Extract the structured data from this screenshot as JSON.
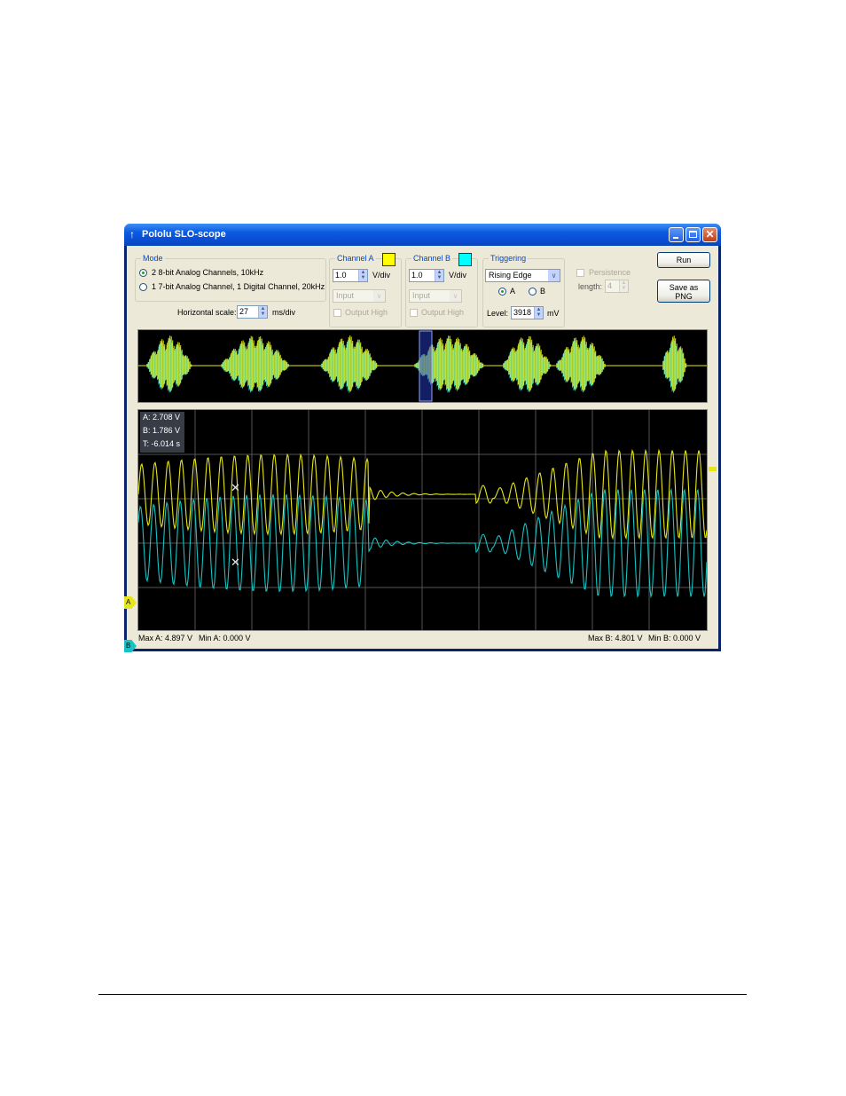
{
  "window": {
    "title": "Pololu SLO-scope"
  },
  "mode": {
    "legend": "Mode",
    "options": [
      "2 8-bit Analog Channels, 10kHz",
      "1 7-bit Analog Channel, 1 Digital Channel, 20kHz"
    ],
    "selected_index": 0,
    "hscale_label": "Horizontal scale:",
    "hscale_value": "27",
    "hscale_unit": "ms/div"
  },
  "channel_a": {
    "legend": "Channel A",
    "color": "#ffff00",
    "vdiv_value": "1.0",
    "vdiv_unit": "V/div",
    "input_select": "Input",
    "output_high_label": "Output High"
  },
  "channel_b": {
    "legend": "Channel B",
    "color": "#00ffff",
    "vdiv_value": "1.0",
    "vdiv_unit": "V/div",
    "input_select": "Input",
    "output_high_label": "Output High"
  },
  "triggering": {
    "legend": "Triggering",
    "type": "Rising Edge",
    "source_options": [
      "A",
      "B"
    ],
    "source_selected": "A",
    "level_label": "Level:",
    "level_value": "3918",
    "level_unit": "mV"
  },
  "persistence": {
    "label": "Persistence",
    "length_label": "length:",
    "length_value": "4"
  },
  "buttons": {
    "run": "Run",
    "save_line1": "Save as",
    "save_line2": "PNG"
  },
  "readout": {
    "a": "A: 2.708 V",
    "b": "B: 1.786 V",
    "t": "T: -6.014 s"
  },
  "markers": {
    "a": "A",
    "b": "B"
  },
  "status": {
    "max_a": "Max A: 4.897 V",
    "min_a": "Min A: 0.000 V",
    "max_b": "Max B: 4.801 V",
    "min_b": "Min B: 0.000 V"
  },
  "colors": {
    "trace_a": "#e6e61a",
    "trace_b": "#19c2c2",
    "titlebar": "#0a5ae0",
    "face": "#ece9d8"
  }
}
